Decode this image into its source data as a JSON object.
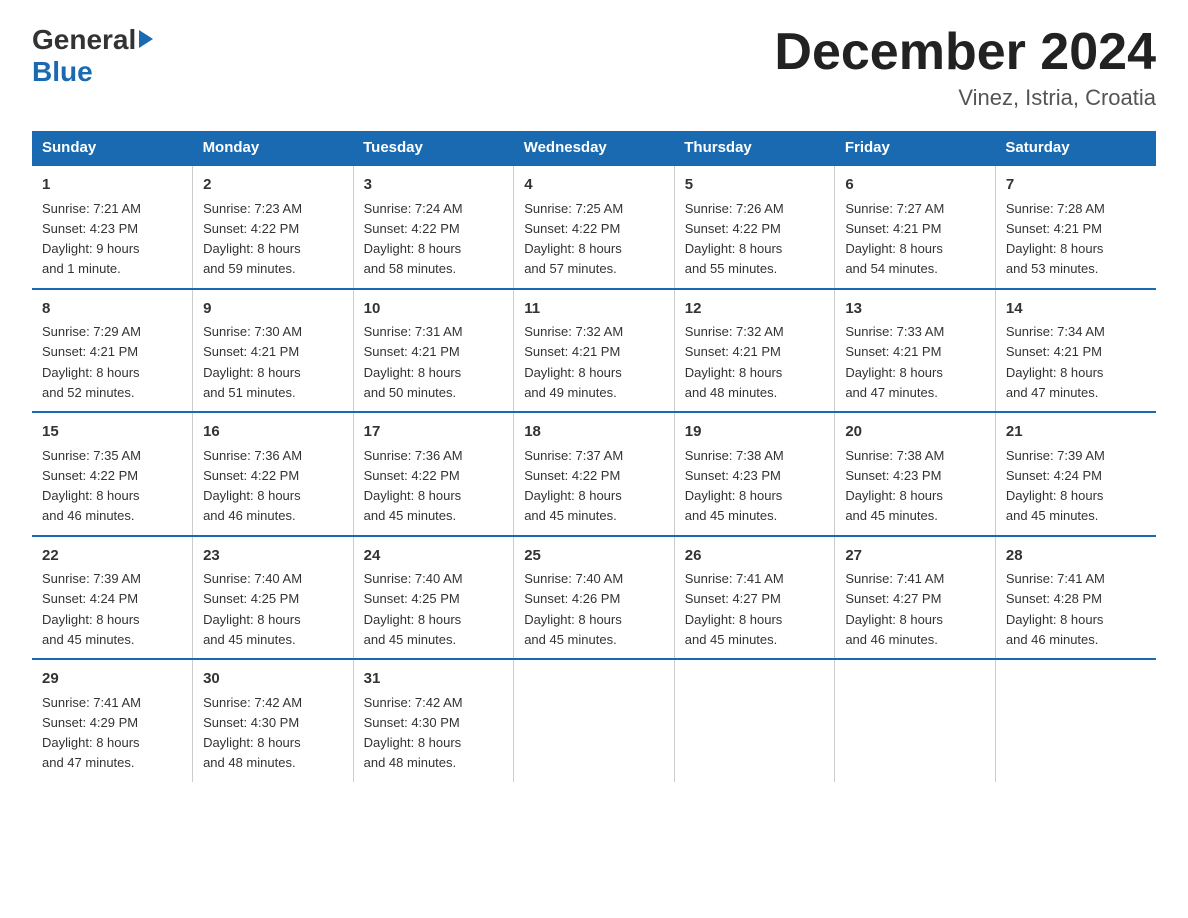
{
  "header": {
    "logo_general": "General",
    "logo_blue": "Blue",
    "month_title": "December 2024",
    "location": "Vinez, Istria, Croatia"
  },
  "weekdays": [
    "Sunday",
    "Monday",
    "Tuesday",
    "Wednesday",
    "Thursday",
    "Friday",
    "Saturday"
  ],
  "weeks": [
    [
      {
        "day": "1",
        "sunrise": "Sunrise: 7:21 AM",
        "sunset": "Sunset: 4:23 PM",
        "daylight": "Daylight: 9 hours",
        "daylight2": "and 1 minute."
      },
      {
        "day": "2",
        "sunrise": "Sunrise: 7:23 AM",
        "sunset": "Sunset: 4:22 PM",
        "daylight": "Daylight: 8 hours",
        "daylight2": "and 59 minutes."
      },
      {
        "day": "3",
        "sunrise": "Sunrise: 7:24 AM",
        "sunset": "Sunset: 4:22 PM",
        "daylight": "Daylight: 8 hours",
        "daylight2": "and 58 minutes."
      },
      {
        "day": "4",
        "sunrise": "Sunrise: 7:25 AM",
        "sunset": "Sunset: 4:22 PM",
        "daylight": "Daylight: 8 hours",
        "daylight2": "and 57 minutes."
      },
      {
        "day": "5",
        "sunrise": "Sunrise: 7:26 AM",
        "sunset": "Sunset: 4:22 PM",
        "daylight": "Daylight: 8 hours",
        "daylight2": "and 55 minutes."
      },
      {
        "day": "6",
        "sunrise": "Sunrise: 7:27 AM",
        "sunset": "Sunset: 4:21 PM",
        "daylight": "Daylight: 8 hours",
        "daylight2": "and 54 minutes."
      },
      {
        "day": "7",
        "sunrise": "Sunrise: 7:28 AM",
        "sunset": "Sunset: 4:21 PM",
        "daylight": "Daylight: 8 hours",
        "daylight2": "and 53 minutes."
      }
    ],
    [
      {
        "day": "8",
        "sunrise": "Sunrise: 7:29 AM",
        "sunset": "Sunset: 4:21 PM",
        "daylight": "Daylight: 8 hours",
        "daylight2": "and 52 minutes."
      },
      {
        "day": "9",
        "sunrise": "Sunrise: 7:30 AM",
        "sunset": "Sunset: 4:21 PM",
        "daylight": "Daylight: 8 hours",
        "daylight2": "and 51 minutes."
      },
      {
        "day": "10",
        "sunrise": "Sunrise: 7:31 AM",
        "sunset": "Sunset: 4:21 PM",
        "daylight": "Daylight: 8 hours",
        "daylight2": "and 50 minutes."
      },
      {
        "day": "11",
        "sunrise": "Sunrise: 7:32 AM",
        "sunset": "Sunset: 4:21 PM",
        "daylight": "Daylight: 8 hours",
        "daylight2": "and 49 minutes."
      },
      {
        "day": "12",
        "sunrise": "Sunrise: 7:32 AM",
        "sunset": "Sunset: 4:21 PM",
        "daylight": "Daylight: 8 hours",
        "daylight2": "and 48 minutes."
      },
      {
        "day": "13",
        "sunrise": "Sunrise: 7:33 AM",
        "sunset": "Sunset: 4:21 PM",
        "daylight": "Daylight: 8 hours",
        "daylight2": "and 47 minutes."
      },
      {
        "day": "14",
        "sunrise": "Sunrise: 7:34 AM",
        "sunset": "Sunset: 4:21 PM",
        "daylight": "Daylight: 8 hours",
        "daylight2": "and 47 minutes."
      }
    ],
    [
      {
        "day": "15",
        "sunrise": "Sunrise: 7:35 AM",
        "sunset": "Sunset: 4:22 PM",
        "daylight": "Daylight: 8 hours",
        "daylight2": "and 46 minutes."
      },
      {
        "day": "16",
        "sunrise": "Sunrise: 7:36 AM",
        "sunset": "Sunset: 4:22 PM",
        "daylight": "Daylight: 8 hours",
        "daylight2": "and 46 minutes."
      },
      {
        "day": "17",
        "sunrise": "Sunrise: 7:36 AM",
        "sunset": "Sunset: 4:22 PM",
        "daylight": "Daylight: 8 hours",
        "daylight2": "and 45 minutes."
      },
      {
        "day": "18",
        "sunrise": "Sunrise: 7:37 AM",
        "sunset": "Sunset: 4:22 PM",
        "daylight": "Daylight: 8 hours",
        "daylight2": "and 45 minutes."
      },
      {
        "day": "19",
        "sunrise": "Sunrise: 7:38 AM",
        "sunset": "Sunset: 4:23 PM",
        "daylight": "Daylight: 8 hours",
        "daylight2": "and 45 minutes."
      },
      {
        "day": "20",
        "sunrise": "Sunrise: 7:38 AM",
        "sunset": "Sunset: 4:23 PM",
        "daylight": "Daylight: 8 hours",
        "daylight2": "and 45 minutes."
      },
      {
        "day": "21",
        "sunrise": "Sunrise: 7:39 AM",
        "sunset": "Sunset: 4:24 PM",
        "daylight": "Daylight: 8 hours",
        "daylight2": "and 45 minutes."
      }
    ],
    [
      {
        "day": "22",
        "sunrise": "Sunrise: 7:39 AM",
        "sunset": "Sunset: 4:24 PM",
        "daylight": "Daylight: 8 hours",
        "daylight2": "and 45 minutes."
      },
      {
        "day": "23",
        "sunrise": "Sunrise: 7:40 AM",
        "sunset": "Sunset: 4:25 PM",
        "daylight": "Daylight: 8 hours",
        "daylight2": "and 45 minutes."
      },
      {
        "day": "24",
        "sunrise": "Sunrise: 7:40 AM",
        "sunset": "Sunset: 4:25 PM",
        "daylight": "Daylight: 8 hours",
        "daylight2": "and 45 minutes."
      },
      {
        "day": "25",
        "sunrise": "Sunrise: 7:40 AM",
        "sunset": "Sunset: 4:26 PM",
        "daylight": "Daylight: 8 hours",
        "daylight2": "and 45 minutes."
      },
      {
        "day": "26",
        "sunrise": "Sunrise: 7:41 AM",
        "sunset": "Sunset: 4:27 PM",
        "daylight": "Daylight: 8 hours",
        "daylight2": "and 45 minutes."
      },
      {
        "day": "27",
        "sunrise": "Sunrise: 7:41 AM",
        "sunset": "Sunset: 4:27 PM",
        "daylight": "Daylight: 8 hours",
        "daylight2": "and 46 minutes."
      },
      {
        "day": "28",
        "sunrise": "Sunrise: 7:41 AM",
        "sunset": "Sunset: 4:28 PM",
        "daylight": "Daylight: 8 hours",
        "daylight2": "and 46 minutes."
      }
    ],
    [
      {
        "day": "29",
        "sunrise": "Sunrise: 7:41 AM",
        "sunset": "Sunset: 4:29 PM",
        "daylight": "Daylight: 8 hours",
        "daylight2": "and 47 minutes."
      },
      {
        "day": "30",
        "sunrise": "Sunrise: 7:42 AM",
        "sunset": "Sunset: 4:30 PM",
        "daylight": "Daylight: 8 hours",
        "daylight2": "and 48 minutes."
      },
      {
        "day": "31",
        "sunrise": "Sunrise: 7:42 AM",
        "sunset": "Sunset: 4:30 PM",
        "daylight": "Daylight: 8 hours",
        "daylight2": "and 48 minutes."
      },
      {
        "day": "",
        "sunrise": "",
        "sunset": "",
        "daylight": "",
        "daylight2": ""
      },
      {
        "day": "",
        "sunrise": "",
        "sunset": "",
        "daylight": "",
        "daylight2": ""
      },
      {
        "day": "",
        "sunrise": "",
        "sunset": "",
        "daylight": "",
        "daylight2": ""
      },
      {
        "day": "",
        "sunrise": "",
        "sunset": "",
        "daylight": "",
        "daylight2": ""
      }
    ]
  ]
}
